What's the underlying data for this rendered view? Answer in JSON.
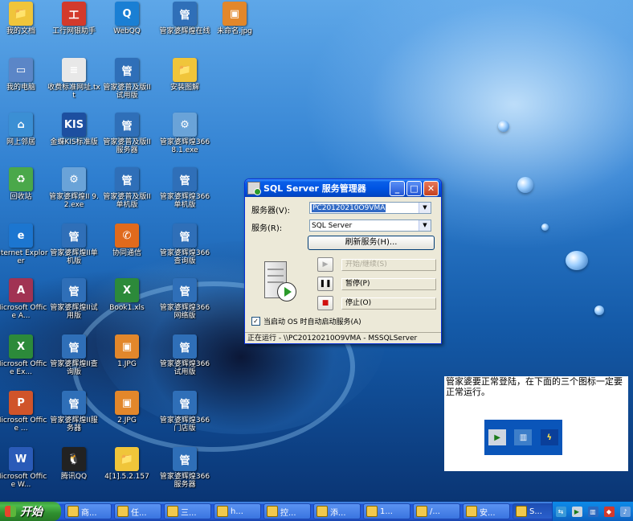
{
  "desktop_icons": [
    {
      "label": "我的文档",
      "icon": "my-documents-icon",
      "color": "#f0c53a",
      "glyph": "📁"
    },
    {
      "label": "工行网银助手",
      "icon": "icbc-helper-icon",
      "color": "#d33a2c",
      "glyph": "工"
    },
    {
      "label": "WebQQ",
      "icon": "webqq-icon",
      "color": "#1a7fd4",
      "glyph": "Q"
    },
    {
      "label": "管家婆辉煌在线",
      "icon": "gjp-online-icon",
      "color": "#2f6fb8",
      "glyph": "管"
    },
    {
      "label": "未命名.jpg",
      "icon": "image-file-icon",
      "color": "#e2872b",
      "glyph": "▣"
    },
    {
      "label": "我的电脑",
      "icon": "my-computer-icon",
      "color": "#5b86c7",
      "glyph": "▭"
    },
    {
      "label": "收费标准网址.txt",
      "icon": "text-file-icon",
      "color": "#e8e8e8",
      "glyph": "≡"
    },
    {
      "label": "管家婆普及版II试用版",
      "icon": "gjp-pop-trial-icon",
      "color": "#2f6fb8",
      "glyph": "管"
    },
    {
      "label": "安装图解",
      "icon": "folder-icon",
      "color": "#f0c53a",
      "glyph": "📁"
    },
    {
      "label": "网上邻居",
      "icon": "network-places-icon",
      "color": "#3b8fd4",
      "glyph": "⌂"
    },
    {
      "label": "金蝶KIS标准版",
      "icon": "kingdee-kis-icon",
      "color": "#1d4fa0",
      "glyph": "KIS"
    },
    {
      "label": "管家婆普及版II服务器",
      "icon": "gjp-pop-server-icon",
      "color": "#2f6fb8",
      "glyph": "管"
    },
    {
      "label": "管家婆辉煌366 8.1.exe",
      "icon": "gjp-installer-icon",
      "color": "#6aa3d8",
      "glyph": "⚙"
    },
    {
      "label": "回收站",
      "icon": "recycle-bin-icon",
      "color": "#4aa84a",
      "glyph": "♻"
    },
    {
      "label": "管家婆辉煌II 9.2.exe",
      "icon": "gjp-installer-icon",
      "color": "#6aa3d8",
      "glyph": "⚙"
    },
    {
      "label": "管家婆普及版II单机版",
      "icon": "gjp-pop-standalone-icon",
      "color": "#2f6fb8",
      "glyph": "管"
    },
    {
      "label": "管家婆辉煌366单机版",
      "icon": "gjp-366-standalone-icon",
      "color": "#2f6fb8",
      "glyph": "管"
    },
    {
      "label": "Internet Explorer",
      "icon": "internet-explorer-icon",
      "color": "#1c76d0",
      "glyph": "e"
    },
    {
      "label": "管家婆辉煌II单机版",
      "icon": "gjp-ii-standalone-icon",
      "color": "#2f6fb8",
      "glyph": "管"
    },
    {
      "label": "协同通信",
      "icon": "collab-comm-icon",
      "color": "#e06a1c",
      "glyph": "✆"
    },
    {
      "label": "管家婆辉煌366查询版",
      "icon": "gjp-366-query-icon",
      "color": "#2f6fb8",
      "glyph": "管"
    },
    {
      "label": "Microsoft Office A...",
      "icon": "ms-access-icon",
      "color": "#a13353",
      "glyph": "A"
    },
    {
      "label": "管家婆辉煌II试用版",
      "icon": "gjp-ii-trial-icon",
      "color": "#2f6fb8",
      "glyph": "管"
    },
    {
      "label": "Book1.xls",
      "icon": "excel-file-icon",
      "color": "#2c8a3a",
      "glyph": "X"
    },
    {
      "label": "管家婆辉煌366网络版",
      "icon": "gjp-366-network-icon",
      "color": "#2f6fb8",
      "glyph": "管"
    },
    {
      "label": "Microsoft Office Ex...",
      "icon": "ms-excel-icon",
      "color": "#2c8a3a",
      "glyph": "X"
    },
    {
      "label": "管家婆辉煌II查询版",
      "icon": "gjp-ii-query-icon",
      "color": "#2f6fb8",
      "glyph": "管"
    },
    {
      "label": "1.JPG",
      "icon": "image-file-icon",
      "color": "#e2872b",
      "glyph": "▣"
    },
    {
      "label": "管家婆辉煌366试用版",
      "icon": "gjp-366-trial-icon",
      "color": "#2f6fb8",
      "glyph": "管"
    },
    {
      "label": "Microsoft Office ...",
      "icon": "ms-powerpoint-icon",
      "color": "#d0542a",
      "glyph": "P"
    },
    {
      "label": "管家婆辉煌II服务器",
      "icon": "gjp-ii-server-icon",
      "color": "#2f6fb8",
      "glyph": "管"
    },
    {
      "label": "2.JPG",
      "icon": "image-file-icon",
      "color": "#e2872b",
      "glyph": "▣"
    },
    {
      "label": "管家婆辉煌366门店版",
      "icon": "gjp-366-store-icon",
      "color": "#2f6fb8",
      "glyph": "管"
    },
    {
      "label": "Microsoft Office W...",
      "icon": "ms-word-icon",
      "color": "#2a5bb8",
      "glyph": "W"
    },
    {
      "label": "腾讯QQ",
      "icon": "tencent-qq-icon",
      "color": "#222222",
      "glyph": "🐧"
    },
    {
      "label": "4[1].5.2.157",
      "icon": "folder-icon",
      "color": "#f0c53a",
      "glyph": "📁"
    },
    {
      "label": "管家婆辉煌366服务器",
      "icon": "gjp-366-server-icon",
      "color": "#2f6fb8",
      "glyph": "管"
    }
  ],
  "service_manager": {
    "title": "SQL Server 服务管理器",
    "server_label": "服务器(V):",
    "server_value": "PC20120210O9VMA",
    "service_label": "服务(R):",
    "service_value": "SQL Server",
    "refresh_button": "刷新服务(H)...",
    "start_label": "开始/继续(S)",
    "pause_label": "暂停(P)",
    "stop_label": "停止(O)",
    "autostart_label": "当启动 OS 时自动启动服务(A)",
    "autostart_checked": true,
    "status": "正在运行 - \\\\PC20120210O9VMA - MSSQLServer"
  },
  "note": {
    "text": "管家婆要正常登陆，在下面的三个图标一定要正常运行。"
  },
  "taskbar": {
    "start_label": "开始",
    "tasks": [
      "商...",
      "任...",
      "三...",
      "h...",
      "控...",
      "添...",
      "1...",
      "/...",
      "安...",
      "S..."
    ]
  },
  "tray_icons": [
    "network-icon",
    "sql-service-icon",
    "gjp-tray-icon",
    "security-icon",
    "volume-icon"
  ]
}
